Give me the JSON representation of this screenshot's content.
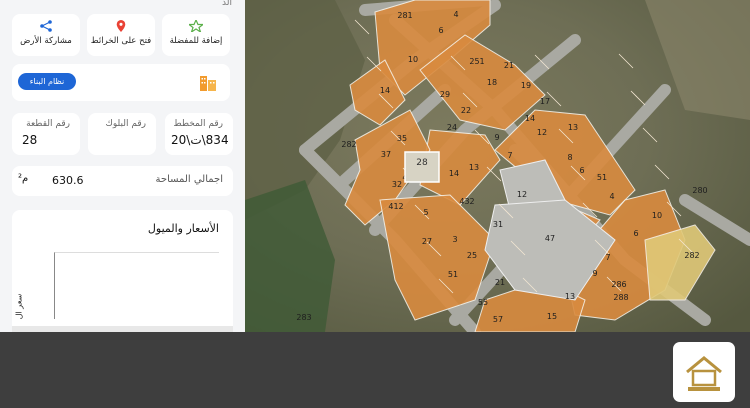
{
  "actions": {
    "favorite_label": "إضافة للمفضلة",
    "maps_label": "فتح على الخرائط",
    "share_label": "مشاركة الأرض"
  },
  "building_system_label": "نظام البناء",
  "info": {
    "plan_label": "رقم المخطط",
    "plan_value": "834\\ت\\20",
    "block_label": "رقم البلوك",
    "block_value": "",
    "parcel_label": "رقم القطعة",
    "parcel_value": "28",
    "area_label": "اجمالي المساحة",
    "area_value": "630.6",
    "area_unit": "م²"
  },
  "prices": {
    "title": "الأسعار والميول",
    "ylabel": "سعر ال"
  },
  "map": {
    "selected_parcel": "28",
    "parcels": [
      "281",
      "4",
      "6",
      "10",
      "251",
      "21",
      "14",
      "29",
      "18",
      "19",
      "17",
      "22",
      "24",
      "14",
      "13",
      "12",
      "35",
      "28",
      "9",
      "7",
      "37",
      "13",
      "412",
      "8",
      "6",
      "51",
      "32",
      "14",
      "412",
      "4",
      "432",
      "12",
      "5",
      "31",
      "10",
      "3",
      "27",
      "47",
      "6",
      "282",
      "25",
      "7",
      "51",
      "9",
      "21",
      "286",
      "55",
      "13",
      "288",
      "57",
      "15",
      "280",
      "283",
      "282"
    ]
  }
}
